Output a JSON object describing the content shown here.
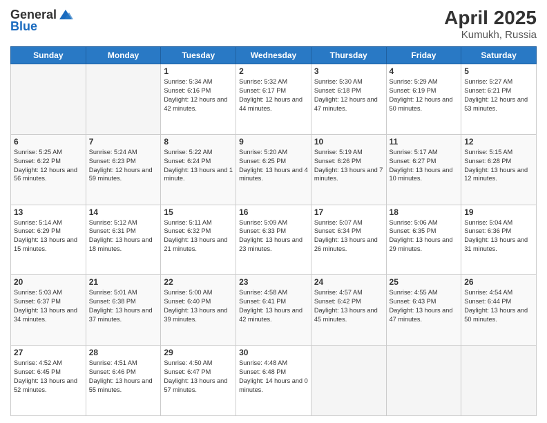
{
  "header": {
    "logo_line1": "General",
    "logo_line2": "Blue",
    "title": "April 2025",
    "subtitle": "Kumukh, Russia"
  },
  "days_of_week": [
    "Sunday",
    "Monday",
    "Tuesday",
    "Wednesday",
    "Thursday",
    "Friday",
    "Saturday"
  ],
  "weeks": [
    [
      null,
      null,
      {
        "day": 1,
        "sunrise": "5:34 AM",
        "sunset": "6:16 PM",
        "daylight": "12 hours and 42 minutes."
      },
      {
        "day": 2,
        "sunrise": "5:32 AM",
        "sunset": "6:17 PM",
        "daylight": "12 hours and 44 minutes."
      },
      {
        "day": 3,
        "sunrise": "5:30 AM",
        "sunset": "6:18 PM",
        "daylight": "12 hours and 47 minutes."
      },
      {
        "day": 4,
        "sunrise": "5:29 AM",
        "sunset": "6:19 PM",
        "daylight": "12 hours and 50 minutes."
      },
      {
        "day": 5,
        "sunrise": "5:27 AM",
        "sunset": "6:21 PM",
        "daylight": "12 hours and 53 minutes."
      }
    ],
    [
      {
        "day": 6,
        "sunrise": "5:25 AM",
        "sunset": "6:22 PM",
        "daylight": "12 hours and 56 minutes."
      },
      {
        "day": 7,
        "sunrise": "5:24 AM",
        "sunset": "6:23 PM",
        "daylight": "12 hours and 59 minutes."
      },
      {
        "day": 8,
        "sunrise": "5:22 AM",
        "sunset": "6:24 PM",
        "daylight": "13 hours and 1 minute."
      },
      {
        "day": 9,
        "sunrise": "5:20 AM",
        "sunset": "6:25 PM",
        "daylight": "13 hours and 4 minutes."
      },
      {
        "day": 10,
        "sunrise": "5:19 AM",
        "sunset": "6:26 PM",
        "daylight": "13 hours and 7 minutes."
      },
      {
        "day": 11,
        "sunrise": "5:17 AM",
        "sunset": "6:27 PM",
        "daylight": "13 hours and 10 minutes."
      },
      {
        "day": 12,
        "sunrise": "5:15 AM",
        "sunset": "6:28 PM",
        "daylight": "13 hours and 12 minutes."
      }
    ],
    [
      {
        "day": 13,
        "sunrise": "5:14 AM",
        "sunset": "6:29 PM",
        "daylight": "13 hours and 15 minutes."
      },
      {
        "day": 14,
        "sunrise": "5:12 AM",
        "sunset": "6:31 PM",
        "daylight": "13 hours and 18 minutes."
      },
      {
        "day": 15,
        "sunrise": "5:11 AM",
        "sunset": "6:32 PM",
        "daylight": "13 hours and 21 minutes."
      },
      {
        "day": 16,
        "sunrise": "5:09 AM",
        "sunset": "6:33 PM",
        "daylight": "13 hours and 23 minutes."
      },
      {
        "day": 17,
        "sunrise": "5:07 AM",
        "sunset": "6:34 PM",
        "daylight": "13 hours and 26 minutes."
      },
      {
        "day": 18,
        "sunrise": "5:06 AM",
        "sunset": "6:35 PM",
        "daylight": "13 hours and 29 minutes."
      },
      {
        "day": 19,
        "sunrise": "5:04 AM",
        "sunset": "6:36 PM",
        "daylight": "13 hours and 31 minutes."
      }
    ],
    [
      {
        "day": 20,
        "sunrise": "5:03 AM",
        "sunset": "6:37 PM",
        "daylight": "13 hours and 34 minutes."
      },
      {
        "day": 21,
        "sunrise": "5:01 AM",
        "sunset": "6:38 PM",
        "daylight": "13 hours and 37 minutes."
      },
      {
        "day": 22,
        "sunrise": "5:00 AM",
        "sunset": "6:40 PM",
        "daylight": "13 hours and 39 minutes."
      },
      {
        "day": 23,
        "sunrise": "4:58 AM",
        "sunset": "6:41 PM",
        "daylight": "13 hours and 42 minutes."
      },
      {
        "day": 24,
        "sunrise": "4:57 AM",
        "sunset": "6:42 PM",
        "daylight": "13 hours and 45 minutes."
      },
      {
        "day": 25,
        "sunrise": "4:55 AM",
        "sunset": "6:43 PM",
        "daylight": "13 hours and 47 minutes."
      },
      {
        "day": 26,
        "sunrise": "4:54 AM",
        "sunset": "6:44 PM",
        "daylight": "13 hours and 50 minutes."
      }
    ],
    [
      {
        "day": 27,
        "sunrise": "4:52 AM",
        "sunset": "6:45 PM",
        "daylight": "13 hours and 52 minutes."
      },
      {
        "day": 28,
        "sunrise": "4:51 AM",
        "sunset": "6:46 PM",
        "daylight": "13 hours and 55 minutes."
      },
      {
        "day": 29,
        "sunrise": "4:50 AM",
        "sunset": "6:47 PM",
        "daylight": "13 hours and 57 minutes."
      },
      {
        "day": 30,
        "sunrise": "4:48 AM",
        "sunset": "6:48 PM",
        "daylight": "14 hours and 0 minutes."
      },
      null,
      null,
      null
    ]
  ]
}
